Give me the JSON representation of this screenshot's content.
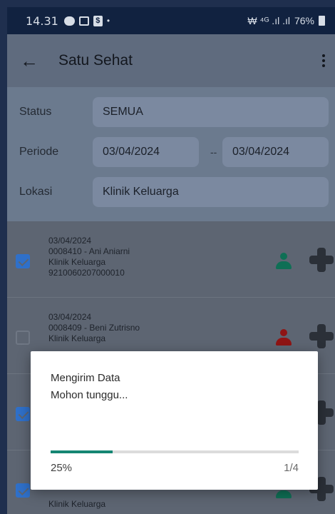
{
  "status_bar": {
    "time": "14.31",
    "dot": "•",
    "network": "₩ ⁴ᴳ .ıl .ıl",
    "battery": "76%"
  },
  "app_bar": {
    "back_icon": "arrow-left",
    "title": "Satu Sehat",
    "menu_icon": "more-vertical"
  },
  "filter": {
    "status_label": "Status",
    "status_value": "SEMUA",
    "period_label": "Periode",
    "period_from": "03/04/2024",
    "period_separator": "--",
    "period_to": "03/04/2024",
    "location_label": "Lokasi",
    "location_value": "Klinik Keluarga"
  },
  "records": [
    {
      "date": "03/04/2024",
      "patient": "0008410 - Ani Aniarni",
      "clinic": "Klinik Keluarga",
      "nik": "9210060207000010",
      "checked": true,
      "person_color": "#0f6f55"
    },
    {
      "date": "03/04/2024",
      "patient": "0008409 - Beni Zutrisno",
      "clinic": "Klinik Keluarga",
      "nik": "",
      "checked": false,
      "person_color": "#8f1414"
    },
    {
      "date": "",
      "patient": "",
      "clinic": "",
      "nik": "",
      "checked": true,
      "person_color": "#0f6f55"
    },
    {
      "date": "",
      "patient": "",
      "clinic": "Klinik Keluarga",
      "nik": "",
      "checked": true,
      "person_color": "#0f6f55"
    }
  ],
  "dialog": {
    "title": "Mengirim Data",
    "message": "Mohon tunggu...",
    "progress": 0.25,
    "percent_text": "25%",
    "count_text": "1/4",
    "accent": "#158673"
  }
}
